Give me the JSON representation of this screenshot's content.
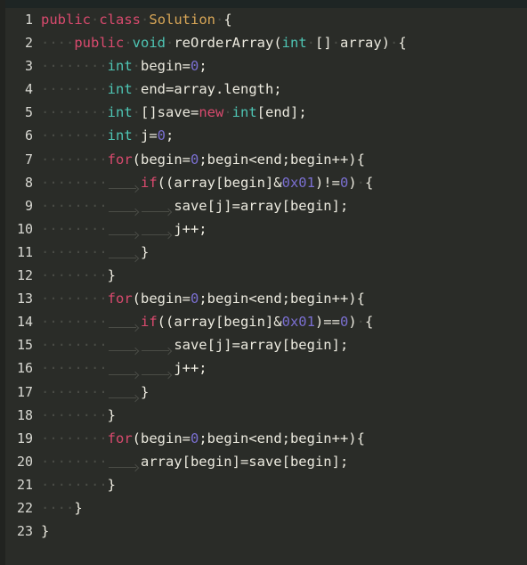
{
  "editor": {
    "theme_name": "dark-monokai-like",
    "background_color": "#2a2c28",
    "top_strip_color": "#1e2524",
    "left_rail_color": "#212320",
    "gutter_color": "#d8d8d2",
    "default_text_color": "#eceadf",
    "whitespace_marker_color": "#4a4c46",
    "token_colors": {
      "keyword": "#d94a6e",
      "type": "#4ec5b4",
      "class_name": "#d8a657",
      "number": "#7a6fd0",
      "plain": "#eceadf"
    },
    "total_lines": 23,
    "language": "Java",
    "lines": [
      {
        "number": "1",
        "indent": {
          "dots": 0,
          "tabs": 0
        },
        "tokens": [
          {
            "t": "public",
            "k": "keyword"
          },
          {
            "t": " ",
            "k": "space-dot"
          },
          {
            "t": "class",
            "k": "keyword"
          },
          {
            "t": " ",
            "k": "space-dot"
          },
          {
            "t": "Solution",
            "k": "class_name"
          },
          {
            "t": " ",
            "k": "space-dot"
          },
          {
            "t": "{",
            "k": "plain"
          }
        ]
      },
      {
        "number": "2",
        "indent": {
          "dots": 4,
          "tabs": 0
        },
        "tokens": [
          {
            "t": "public",
            "k": "keyword"
          },
          {
            "t": " ",
            "k": "space-dot"
          },
          {
            "t": "void",
            "k": "type"
          },
          {
            "t": " ",
            "k": "space-dot"
          },
          {
            "t": "reOrderArray(",
            "k": "plain"
          },
          {
            "t": "int",
            "k": "type"
          },
          {
            "t": " ",
            "k": "space-dot"
          },
          {
            "t": "[]",
            "k": "plain"
          },
          {
            "t": " ",
            "k": "space-dot"
          },
          {
            "t": "array)",
            "k": "plain"
          },
          {
            "t": " ",
            "k": "space-dot"
          },
          {
            "t": "{",
            "k": "plain"
          }
        ]
      },
      {
        "number": "3",
        "indent": {
          "dots": 8,
          "tabs": 0
        },
        "tokens": [
          {
            "t": "int",
            "k": "type"
          },
          {
            "t": " ",
            "k": "space-dot"
          },
          {
            "t": "begin=",
            "k": "plain"
          },
          {
            "t": "0",
            "k": "number"
          },
          {
            "t": ";",
            "k": "plain"
          }
        ]
      },
      {
        "number": "4",
        "indent": {
          "dots": 8,
          "tabs": 0
        },
        "tokens": [
          {
            "t": "int",
            "k": "type"
          },
          {
            "t": " ",
            "k": "space-dot"
          },
          {
            "t": "end=array.length;",
            "k": "plain"
          }
        ]
      },
      {
        "number": "5",
        "indent": {
          "dots": 8,
          "tabs": 0
        },
        "tokens": [
          {
            "t": "int",
            "k": "type"
          },
          {
            "t": " ",
            "k": "space-dot"
          },
          {
            "t": "[]save=",
            "k": "plain"
          },
          {
            "t": "new",
            "k": "keyword"
          },
          {
            "t": " ",
            "k": "space-dot"
          },
          {
            "t": "int",
            "k": "type"
          },
          {
            "t": "[end];",
            "k": "plain"
          }
        ]
      },
      {
        "number": "6",
        "indent": {
          "dots": 8,
          "tabs": 0
        },
        "tokens": [
          {
            "t": "int",
            "k": "type"
          },
          {
            "t": " ",
            "k": "space-dot"
          },
          {
            "t": "j=",
            "k": "plain"
          },
          {
            "t": "0",
            "k": "number"
          },
          {
            "t": ";",
            "k": "plain"
          }
        ]
      },
      {
        "number": "7",
        "indent": {
          "dots": 8,
          "tabs": 0
        },
        "tokens": [
          {
            "t": "for",
            "k": "keyword"
          },
          {
            "t": "(begin=",
            "k": "plain"
          },
          {
            "t": "0",
            "k": "number"
          },
          {
            "t": ";begin<end;begin++){",
            "k": "plain"
          }
        ]
      },
      {
        "number": "8",
        "indent": {
          "dots": 8,
          "tabs": 1
        },
        "tokens": [
          {
            "t": "if",
            "k": "keyword"
          },
          {
            "t": "((array[begin]&",
            "k": "plain"
          },
          {
            "t": "0x01",
            "k": "number"
          },
          {
            "t": ")!=",
            "k": "plain"
          },
          {
            "t": "0",
            "k": "number"
          },
          {
            "t": ")",
            "k": "plain"
          },
          {
            "t": " ",
            "k": "space-dot"
          },
          {
            "t": "{",
            "k": "plain"
          }
        ]
      },
      {
        "number": "9",
        "indent": {
          "dots": 8,
          "tabs": 2
        },
        "tokens": [
          {
            "t": "save[j]=array[begin];",
            "k": "plain"
          }
        ]
      },
      {
        "number": "10",
        "indent": {
          "dots": 8,
          "tabs": 2
        },
        "tokens": [
          {
            "t": "j++;",
            "k": "plain"
          }
        ]
      },
      {
        "number": "11",
        "indent": {
          "dots": 8,
          "tabs": 1
        },
        "tokens": [
          {
            "t": "}",
            "k": "plain"
          }
        ]
      },
      {
        "number": "12",
        "indent": {
          "dots": 8,
          "tabs": 0
        },
        "tokens": [
          {
            "t": "}",
            "k": "plain"
          }
        ]
      },
      {
        "number": "13",
        "indent": {
          "dots": 8,
          "tabs": 0
        },
        "tokens": [
          {
            "t": "for",
            "k": "keyword"
          },
          {
            "t": "(begin=",
            "k": "plain"
          },
          {
            "t": "0",
            "k": "number"
          },
          {
            "t": ";begin<end;begin++){",
            "k": "plain"
          }
        ]
      },
      {
        "number": "14",
        "indent": {
          "dots": 8,
          "tabs": 1
        },
        "tokens": [
          {
            "t": "if",
            "k": "keyword"
          },
          {
            "t": "((array[begin]&",
            "k": "plain"
          },
          {
            "t": "0x01",
            "k": "number"
          },
          {
            "t": ")==",
            "k": "plain"
          },
          {
            "t": "0",
            "k": "number"
          },
          {
            "t": ")",
            "k": "plain"
          },
          {
            "t": " ",
            "k": "space-dot"
          },
          {
            "t": "{",
            "k": "plain"
          }
        ]
      },
      {
        "number": "15",
        "indent": {
          "dots": 8,
          "tabs": 2
        },
        "tokens": [
          {
            "t": "save[j]=array[begin];",
            "k": "plain"
          }
        ]
      },
      {
        "number": "16",
        "indent": {
          "dots": 8,
          "tabs": 2
        },
        "tokens": [
          {
            "t": "j++;",
            "k": "plain"
          }
        ]
      },
      {
        "number": "17",
        "indent": {
          "dots": 8,
          "tabs": 1
        },
        "tokens": [
          {
            "t": "}",
            "k": "plain"
          }
        ]
      },
      {
        "number": "18",
        "indent": {
          "dots": 8,
          "tabs": 0
        },
        "tokens": [
          {
            "t": "}",
            "k": "plain"
          }
        ]
      },
      {
        "number": "19",
        "indent": {
          "dots": 8,
          "tabs": 0
        },
        "tokens": [
          {
            "t": "for",
            "k": "keyword"
          },
          {
            "t": "(begin=",
            "k": "plain"
          },
          {
            "t": "0",
            "k": "number"
          },
          {
            "t": ";begin<end;begin++){",
            "k": "plain"
          }
        ]
      },
      {
        "number": "20",
        "indent": {
          "dots": 8,
          "tabs": 1
        },
        "tokens": [
          {
            "t": "array[begin]=save[begin];",
            "k": "plain"
          }
        ]
      },
      {
        "number": "21",
        "indent": {
          "dots": 8,
          "tabs": 0
        },
        "tokens": [
          {
            "t": "}",
            "k": "plain"
          }
        ]
      },
      {
        "number": "22",
        "indent": {
          "dots": 4,
          "tabs": 0
        },
        "tokens": [
          {
            "t": "}",
            "k": "plain"
          }
        ]
      },
      {
        "number": "23",
        "indent": {
          "dots": 0,
          "tabs": 0
        },
        "tokens": [
          {
            "t": "}",
            "k": "plain"
          }
        ]
      }
    ]
  }
}
